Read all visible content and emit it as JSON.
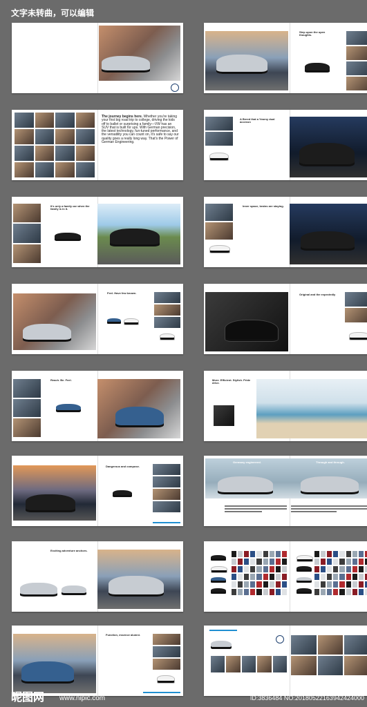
{
  "header_note": "文字未转曲，可以编辑",
  "spreads": [
    {
      "heading": "",
      "body": ""
    },
    {
      "heading": "Step upon the open thoughts.",
      "body": ""
    },
    {
      "heading": "The journey begins here.",
      "body": "Whether you're taking your first big road trip to college, driving the kids off to ballet or surprising a family—VW has an SUV that is built for ups. With German precision, the latest technology, fun-tuned performance, and the versatility you can count on, it's safe to say our quality goes a really long way. That's the Power of German Engineering."
    },
    {
      "heading": "A Breed that a Yearny dual accessn",
      "body": ""
    },
    {
      "heading": "It's only a family car when the family is in it.",
      "body": ""
    },
    {
      "heading": "Inner space, brains are staying.",
      "body": ""
    },
    {
      "heading": "Feel. Have few known.",
      "body": ""
    },
    {
      "heading": "Original and the expectedly",
      "body": ""
    },
    {
      "heading": "Reach. Be. Feel.",
      "body": ""
    },
    {
      "heading": "More. Efficient. Stylish. Pride drive.",
      "body": ""
    },
    {
      "heading": "Dangerous and compose.",
      "body": ""
    },
    {
      "heading": "Germany engineered.",
      "body": ""
    },
    {
      "heading": "Through and through.",
      "body": ""
    },
    {
      "heading": "Exciting adventure anchors.",
      "body": ""
    },
    {
      "heading": "",
      "body": ""
    },
    {
      "heading": "Function, essence alumni.",
      "body": ""
    }
  ],
  "watermark": {
    "brand": "昵图网",
    "url": "www.nipic.com",
    "id_text": "ID:3836484 NO:20180522163942424000"
  },
  "colors": {
    "background": "#6b6b6b",
    "accent": "#1f8fd1",
    "swatch_palette": [
      "#1a1a1a",
      "#c8ccd0",
      "#8a1c24",
      "#2b4f86",
      "#dfe2e5",
      "#3c3c3c",
      "#9aa7b3",
      "#5a6f91",
      "#b02a2e"
    ]
  }
}
